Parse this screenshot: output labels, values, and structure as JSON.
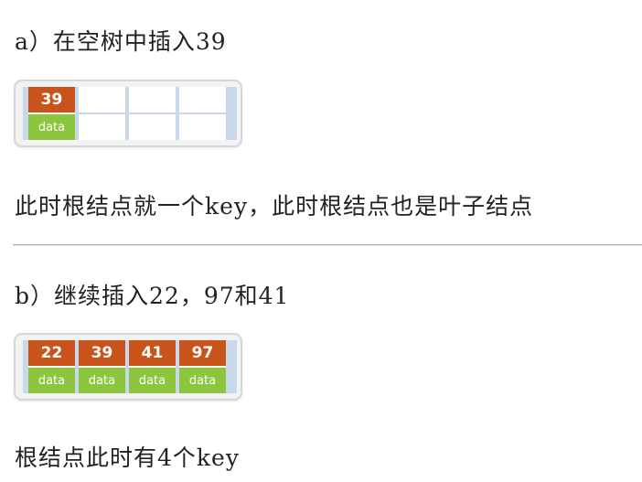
{
  "section_a": {
    "heading": "a）在空树中插入39",
    "description": "此时根结点就一个key，此时根结点也是叶子结点",
    "node": {
      "slots": [
        {
          "key": "39",
          "data": "data"
        },
        {
          "key": "",
          "data": ""
        },
        {
          "key": "",
          "data": ""
        },
        {
          "key": "",
          "data": ""
        }
      ]
    }
  },
  "section_b": {
    "heading": "b）继续插入22，97和41",
    "description": "根结点此时有4个key",
    "node": {
      "slots": [
        {
          "key": "22",
          "data": "data"
        },
        {
          "key": "39",
          "data": "data"
        },
        {
          "key": "41",
          "data": "data"
        },
        {
          "key": "97",
          "data": "data"
        }
      ]
    }
  },
  "colors": {
    "key_cell": "#c8541c",
    "data_cell": "#8cc63e",
    "node_border": "#d6d6d6",
    "slot_divider": "#c9d8ea"
  }
}
